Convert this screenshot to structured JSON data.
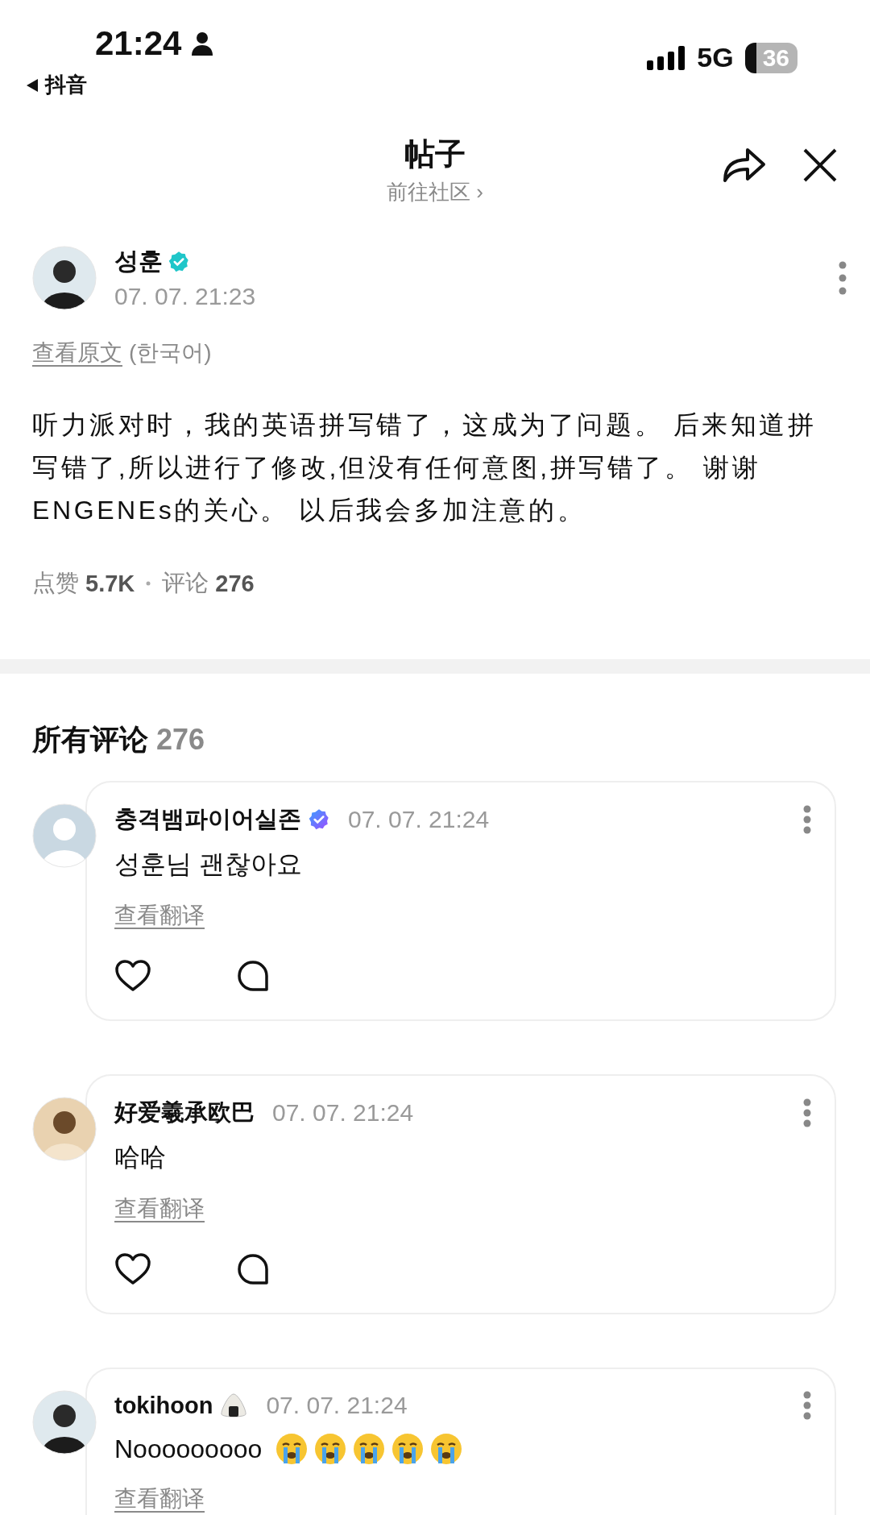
{
  "status_bar": {
    "time": "21:24",
    "back_app": "抖音",
    "network": "5G",
    "battery": "36"
  },
  "header": {
    "title": "帖子",
    "subtitle": "前往社区 ›"
  },
  "post": {
    "author": "성훈",
    "verified": true,
    "avatar": {
      "kind": "photo"
    },
    "time": "07. 07. 21:23",
    "original_link": "查看原文",
    "original_lang": "(한국어)",
    "body": "听力派对时，我的英语拼写错了，这成为了问题。 后来知道拼写错了,所以进行了修改,但没有任何意图,拼写错了。 谢谢ENGENEs的关心。 以后我会多加注意的。",
    "likes_label": "点赞",
    "likes": "5.7K",
    "comments_label": "评论",
    "comments": "276"
  },
  "comments_section": {
    "title": "所有评论",
    "count": "276"
  },
  "comments": [
    {
      "user": "충격뱀파이어실존",
      "badge": {
        "kind": "verified"
      },
      "avatar": {
        "kind": "default"
      },
      "time": "07. 07. 21:24",
      "text": "성훈님 괜찮아요",
      "translate": "查看翻译",
      "actions": [
        {
          "kind": "like"
        },
        {
          "kind": "reply"
        }
      ]
    },
    {
      "user": "好爱羲承欧巴",
      "avatar": {
        "kind": "cartoon"
      },
      "time": "07. 07. 21:24",
      "text": "哈哈",
      "translate": "查看翻译",
      "actions": [
        {
          "kind": "like"
        },
        {
          "kind": "reply"
        }
      ]
    },
    {
      "user": "tokihoon",
      "badge": {
        "kind": "onigiri"
      },
      "avatar": {
        "kind": "photo"
      },
      "time": "07. 07. 21:24",
      "text": "Nooooooooo",
      "reactions": [
        {
          "kind": "crying"
        },
        {
          "kind": "crying"
        },
        {
          "kind": "crying"
        },
        {
          "kind": "crying"
        },
        {
          "kind": "crying"
        }
      ],
      "translate": "查看翻译"
    }
  ]
}
